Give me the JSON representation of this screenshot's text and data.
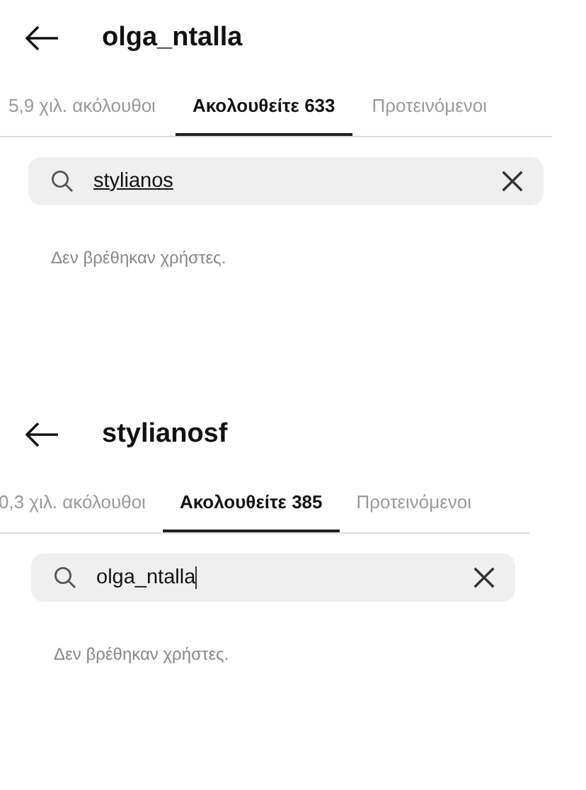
{
  "panels": [
    {
      "title": "olga_ntalla",
      "tabs": [
        {
          "label": "5,9 χιλ. ακόλουθοι",
          "selected": false
        },
        {
          "label": "Ακολουθείτε 633",
          "selected": true
        },
        {
          "label": "Προτεινόμενοι",
          "selected": false
        }
      ],
      "search": {
        "value": "stylianos"
      },
      "message": "Δεν βρέθηκαν χρήστες."
    },
    {
      "title": "stylianosf",
      "tabs": [
        {
          "label": "0,3 χιλ. ακόλουθοι",
          "selected": false
        },
        {
          "label": "Ακολουθείτε 385",
          "selected": true
        },
        {
          "label": "Προτεινόμενοι",
          "selected": false
        }
      ],
      "search": {
        "value": "olga_ntalla"
      },
      "message": "Δεν βρέθηκαν χρήστες."
    }
  ]
}
